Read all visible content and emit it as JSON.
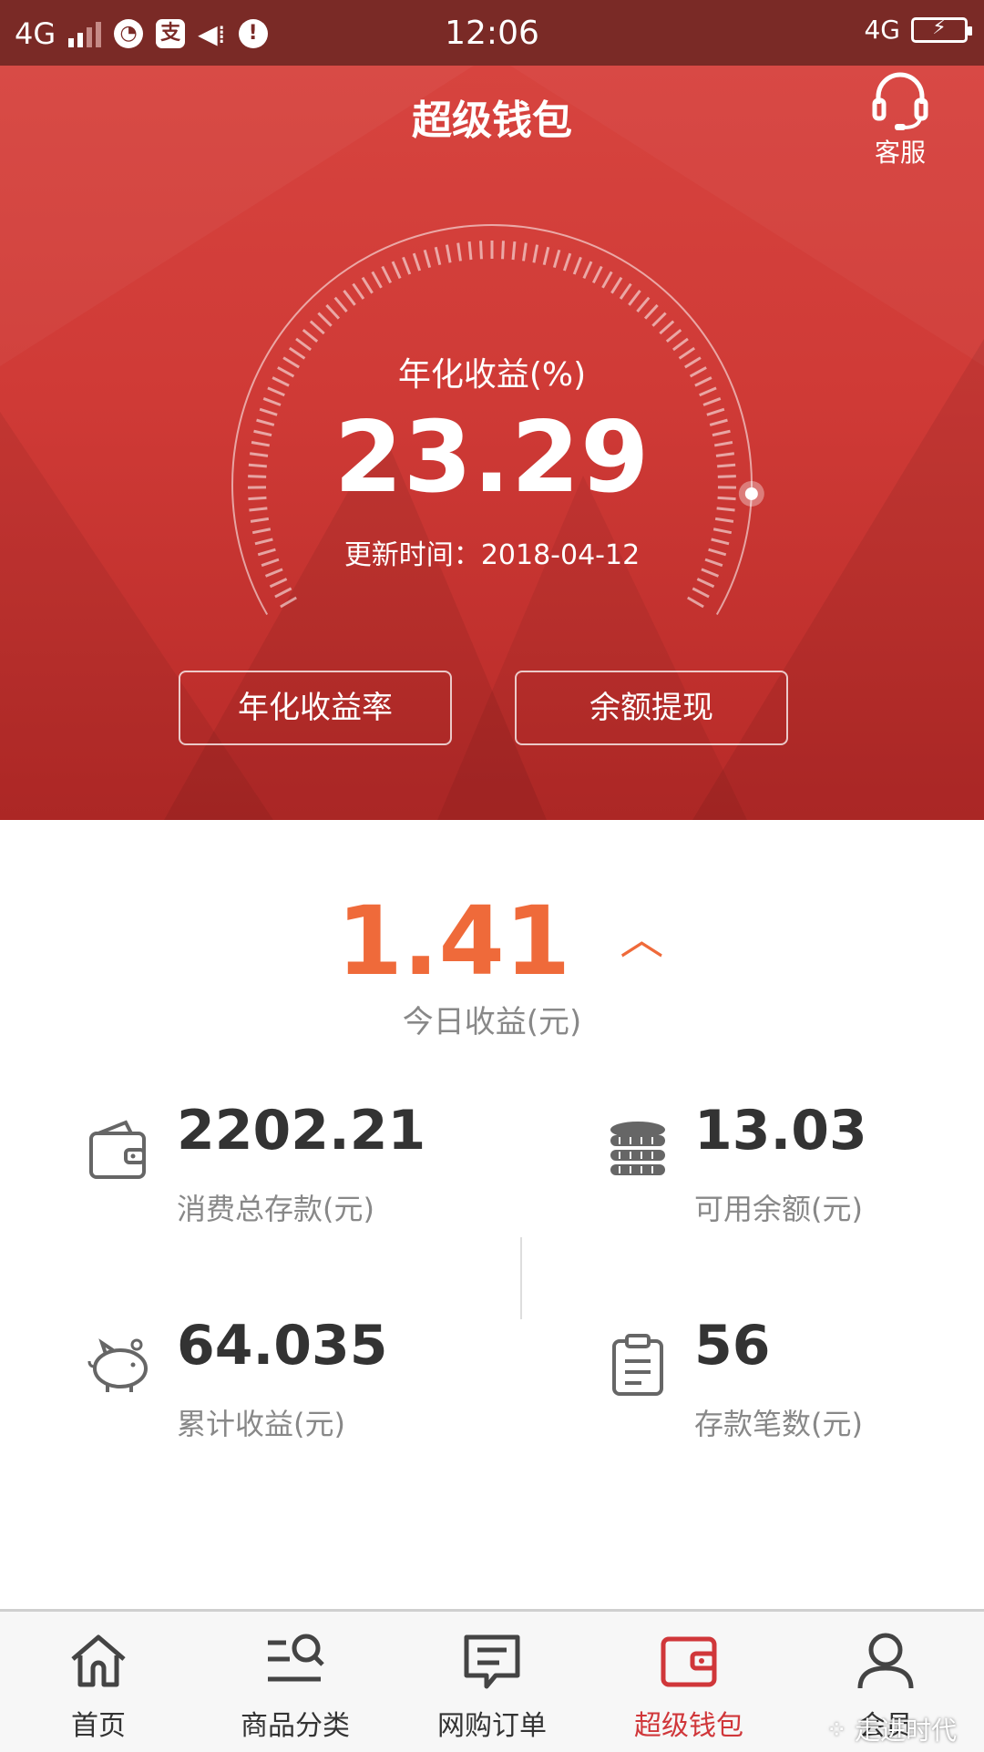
{
  "status_bar": {
    "network_left": "4G",
    "time": "12:06",
    "network_right": "4G",
    "icons": [
      "signal-icon",
      "browser-icon",
      "alipay-icon",
      "vibrate-icon",
      "alert-icon",
      "battery-charging-icon"
    ]
  },
  "header": {
    "title": "超级钱包",
    "customer_service_label": "客服"
  },
  "gauge": {
    "label": "年化收益(%)",
    "value": "23.29",
    "update_label": "更新时间：",
    "update_date": "2018-04-12"
  },
  "hero_buttons": {
    "rate": "年化收益率",
    "withdraw": "余额提现"
  },
  "today": {
    "value": "1.41",
    "label": "今日收益(元)"
  },
  "stats": [
    {
      "value": "2202.21",
      "label": "消费总存款(元)",
      "icon": "wallet-icon"
    },
    {
      "value": "13.03",
      "label": "可用余额(元)",
      "icon": "coins-icon"
    },
    {
      "value": "64.035",
      "label": "累计收益(元)",
      "icon": "piggy-bank-icon"
    },
    {
      "value": "56",
      "label": "存款笔数(元)",
      "icon": "clipboard-icon"
    }
  ],
  "bottom_nav": [
    {
      "label": "首页",
      "icon": "home-icon",
      "active": false
    },
    {
      "label": "商品分类",
      "icon": "category-search-icon",
      "active": false
    },
    {
      "label": "网购订单",
      "icon": "order-icon",
      "active": false
    },
    {
      "label": "超级钱包",
      "icon": "wallet-icon",
      "active": true
    },
    {
      "label": "会员",
      "icon": "user-icon",
      "active": false
    }
  ],
  "watermark": "走进时代",
  "colors": {
    "status_bar": "#7a2a26",
    "hero": "#d0403c",
    "accent_orange": "#ef6a3a",
    "active_nav": "#d0373a"
  }
}
